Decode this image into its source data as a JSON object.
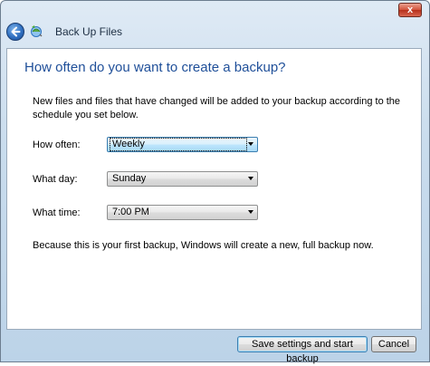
{
  "window": {
    "title": "Back Up Files",
    "close_glyph": "x"
  },
  "icons": {
    "back": "back-arrow-icon",
    "app": "backup-icon",
    "close": "close-icon",
    "dropdown": "chevron-down-icon"
  },
  "main": {
    "heading": "How often do you want to create a backup?",
    "description": "New files and files that have changed will be added to your backup according to the schedule you set below.",
    "fields": {
      "how_often": {
        "label": "How often:",
        "value": "Weekly"
      },
      "what_day": {
        "label": "What day:",
        "value": "Sunday"
      },
      "what_time": {
        "label": "What time:",
        "value": "7:00 PM"
      }
    },
    "note": "Because this is your first backup, Windows will create a new, full backup now."
  },
  "buttons": {
    "save": "Save settings and start backup",
    "cancel": "Cancel"
  },
  "colors": {
    "heading": "#1f4f99",
    "focus_border": "#3c7fb1"
  }
}
